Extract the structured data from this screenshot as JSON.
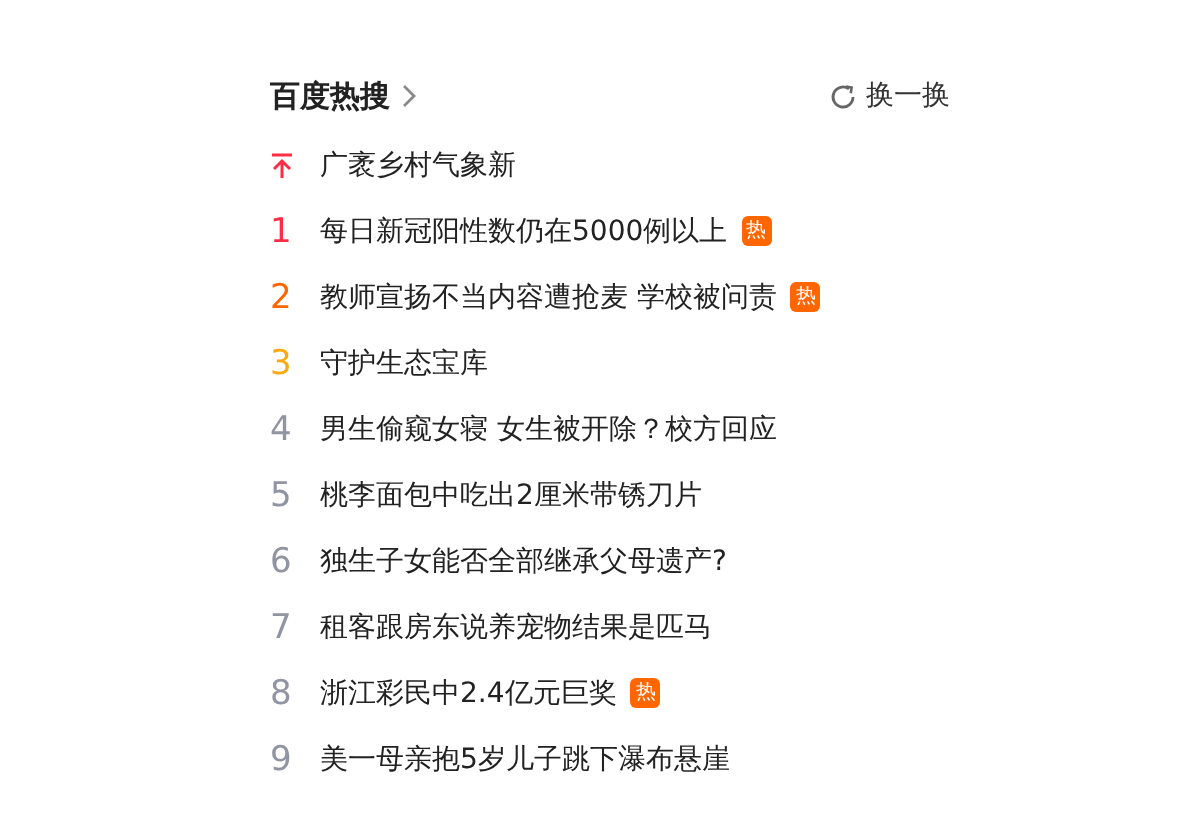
{
  "header": {
    "title": "百度热搜",
    "refresh_label": "换一换"
  },
  "items": [
    {
      "kind": "pinned",
      "title": "广袤乡村气象新"
    },
    {
      "kind": "ranked",
      "rank": "1",
      "color": "#fe2d46",
      "title": "每日新冠阳性数仍在5000例以上",
      "badge": "热"
    },
    {
      "kind": "ranked",
      "rank": "2",
      "color": "#ff6600",
      "title": "教师宣扬不当内容遭抢麦 学校被问责",
      "badge": "热"
    },
    {
      "kind": "ranked",
      "rank": "3",
      "color": "#faa90e",
      "title": "守护生态宝库"
    },
    {
      "kind": "ranked",
      "rank": "4",
      "color": "#9195a3",
      "title": "男生偷窥女寝 女生被开除？校方回应"
    },
    {
      "kind": "ranked",
      "rank": "5",
      "color": "#9195a3",
      "title": "桃李面包中吃出2厘米带锈刀片"
    },
    {
      "kind": "ranked",
      "rank": "6",
      "color": "#9195a3",
      "title": "独生子女能否全部继承父母遗产?"
    },
    {
      "kind": "ranked",
      "rank": "7",
      "color": "#9195a3",
      "title": "租客跟房东说养宠物结果是匹马"
    },
    {
      "kind": "ranked",
      "rank": "8",
      "color": "#9195a3",
      "title": "浙江彩民中2.4亿元巨奖",
      "badge": "热"
    },
    {
      "kind": "ranked",
      "rank": "9",
      "color": "#9195a3",
      "title": "美一母亲抱5岁儿子跳下瀑布悬崖"
    }
  ]
}
